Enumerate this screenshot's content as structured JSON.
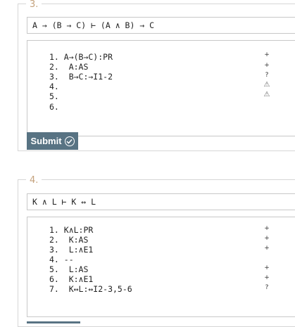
{
  "questions": [
    {
      "number": "3.",
      "formula": "A → (B → C) ⊢ (A ∧ B) → C",
      "lines": [
        {
          "text": "1. A→(B→C):PR",
          "mark": "+"
        },
        {
          "text": "2.  A:AS",
          "mark": "+"
        },
        {
          "text": "3.  B→C:→I1-2",
          "mark": "?"
        },
        {
          "text": "4.",
          "mark": "⚠"
        },
        {
          "text": "5.",
          "mark": "⚠"
        },
        {
          "text": "6.",
          "mark": ""
        }
      ],
      "submit_label": "Submit"
    },
    {
      "number": "4.",
      "formula": "K ∧ L ⊢ K ↔ L",
      "lines": [
        {
          "text": "1. K∧L:PR",
          "mark": "+"
        },
        {
          "text": "2.  K:AS",
          "mark": "+"
        },
        {
          "text": "3.  L:∧E1",
          "mark": "+"
        },
        {
          "text": "4. --",
          "mark": ""
        },
        {
          "text": "5.  L:AS",
          "mark": "+"
        },
        {
          "text": "6.  K:∧E1",
          "mark": "+"
        },
        {
          "text": "7.  K↔L:↔I2-3,5-6",
          "mark": "?"
        }
      ]
    }
  ]
}
